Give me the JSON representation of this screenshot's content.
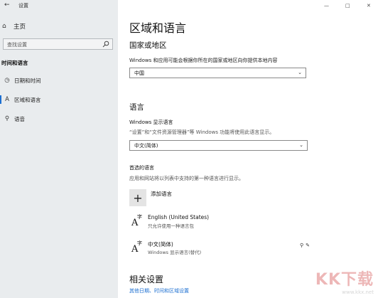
{
  "window": {
    "title": "设置",
    "controls": [
      "—",
      "□",
      "✕"
    ]
  },
  "sidebar": {
    "home_label": "主页",
    "search_placeholder": "查找设置",
    "section_title": "时间和语言",
    "items": [
      {
        "label": "日期和时间",
        "icon": "calendar-clock-icon"
      },
      {
        "label": "区域和语言",
        "icon": "region-language-icon",
        "active": true
      },
      {
        "label": "语音",
        "icon": "microphone-icon"
      }
    ]
  },
  "main": {
    "page_title": "区域和语言",
    "country": {
      "heading": "国家或地区",
      "description": "Windows 和应用可能会根据你所在的国家或地区向你提供本地内容",
      "selected": "中国"
    },
    "language": {
      "heading": "语言",
      "display_label": "Windows 显示语言",
      "display_description": "“设置”和“文件资源管理器”等 Windows 功能将使用此语言显示。",
      "display_selected": "中文(简体)",
      "preferred_label": "首选的语言",
      "preferred_description": "应用和网站将以列表中支持的第一种语言进行显示。",
      "add_label": "添加语言",
      "entries": [
        {
          "name": "English (United States)",
          "sub": "只允许使用一种语言包"
        },
        {
          "name": "中文(简体)",
          "sub": "Windows 显示语言(替代)"
        }
      ]
    },
    "related": {
      "heading": "相关设置",
      "link": "其他日期、时间和区域设置"
    }
  },
  "watermark": {
    "brand": "KK下载",
    "url": "www.kkx.net"
  }
}
